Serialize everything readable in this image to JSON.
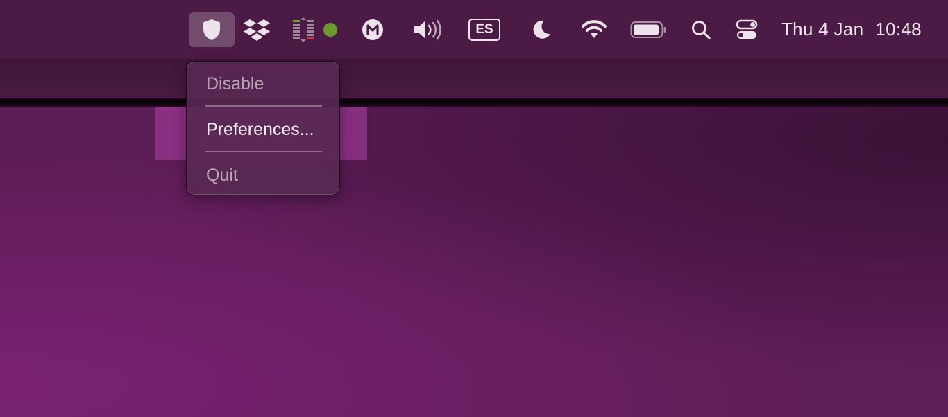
{
  "menubar": {
    "icons": [
      {
        "name": "shield-icon",
        "active": true
      },
      {
        "name": "dropbox-icon"
      },
      {
        "name": "activity-meter-icon"
      },
      {
        "name": "status-dot-icon",
        "color": "#6a9a2e"
      },
      {
        "name": "mega-icon"
      },
      {
        "name": "volume-icon"
      },
      {
        "name": "wifi-icon"
      },
      {
        "name": "battery-icon"
      },
      {
        "name": "search-icon"
      },
      {
        "name": "control-center-icon"
      }
    ],
    "input_source": "ES",
    "date": "Thu 4 Jan",
    "time": "10:48"
  },
  "dropdown": {
    "items": [
      {
        "label": "Disable",
        "enabled": false
      },
      {
        "label": "Preferences...",
        "enabled": true
      },
      {
        "label": "Quit",
        "enabled": false
      }
    ]
  },
  "colors": {
    "menubar_bg": "#4b1a45",
    "menu_bg": "#582852",
    "wallpaper": "#5c1c55",
    "highlight": "#b040a8",
    "status_dot": "#6a9a2e"
  }
}
